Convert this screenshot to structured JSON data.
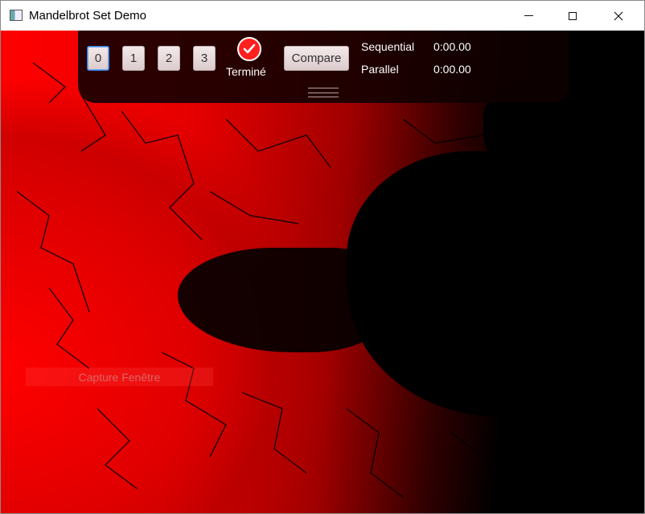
{
  "window": {
    "title": "Mandelbrot Set Demo",
    "icon": "app-window-icon",
    "controls": [
      "minimize-icon",
      "maximize-icon",
      "close-icon"
    ]
  },
  "toolbar": {
    "mode_buttons": [
      "0",
      "1",
      "2",
      "3"
    ],
    "selected_mode": "0",
    "status": {
      "icon": "checkmark-icon",
      "label": "Terminé"
    },
    "compare_label": "Compare",
    "timings": [
      {
        "label": "Sequential",
        "value": "0:00.00"
      },
      {
        "label": "Parallel",
        "value": "0:00.00"
      }
    ]
  },
  "overlay": {
    "capture_label": "Capture Fenêtre"
  },
  "colors": {
    "fractal_fill": "#ff0000",
    "set_color": "#000000",
    "toolbar_bg": "#0f0000",
    "accent": "#3c7fd6"
  }
}
